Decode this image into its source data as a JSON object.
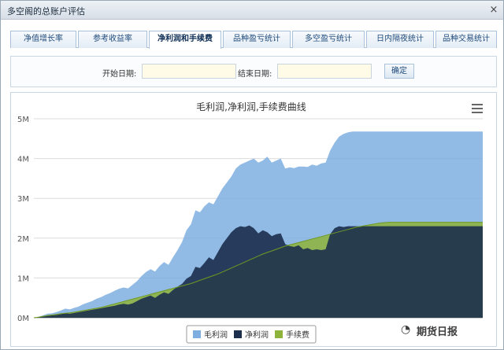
{
  "window": {
    "title": "多空阁的总账户评估",
    "close_glyph": "×"
  },
  "tabs": [
    {
      "label": "净值增长率",
      "active": false
    },
    {
      "label": "参考收益率",
      "active": false
    },
    {
      "label": "净利润和手续费",
      "active": true
    },
    {
      "label": "品种盈亏统计",
      "active": false
    },
    {
      "label": "多空盈亏统计",
      "active": false
    },
    {
      "label": "日内隔夜统计",
      "active": false
    },
    {
      "label": "品种交易统计",
      "active": false
    }
  ],
  "filter": {
    "start_label": "开始日期:",
    "start_value": "",
    "end_label": "结束日期:",
    "end_value": "",
    "confirm_label": "确定"
  },
  "menu_icon": "hamburger-menu-icon",
  "watermark": {
    "icon": "wechat-icon",
    "text": "期货日报"
  },
  "chart_data": {
    "type": "area",
    "title": "毛利润,净利润,手续费曲线",
    "xlabel": "",
    "ylabel": "",
    "ylim": [
      0,
      5000000
    ],
    "yticks": [
      "0M",
      "1M",
      "2M",
      "3M",
      "4M",
      "5M"
    ],
    "grid": true,
    "legend_position": "bottom",
    "x": [
      0,
      1,
      2,
      3,
      4,
      5,
      6,
      7,
      8,
      9,
      10,
      11,
      12,
      13,
      14,
      15,
      16,
      17,
      18,
      19,
      20,
      21,
      22,
      23,
      24,
      25,
      26,
      27,
      28,
      29,
      30,
      31,
      32,
      33,
      34,
      35,
      36,
      37,
      38,
      39,
      40,
      41,
      42,
      43,
      44,
      45,
      46,
      47,
      48,
      49,
      50,
      51,
      52,
      53,
      54,
      55,
      56,
      57,
      58,
      59,
      60,
      61,
      62,
      63,
      64,
      65,
      66,
      67,
      68,
      69,
      70,
      71,
      72,
      73,
      74,
      75,
      76,
      77,
      78,
      79,
      80,
      81,
      82,
      83,
      84,
      85,
      86,
      87,
      88,
      89,
      90,
      91,
      92,
      93,
      94,
      95,
      96,
      97,
      98,
      99,
      100
    ],
    "series": [
      {
        "name": "毛利润",
        "color": "#7eaee0",
        "values": [
          0,
          20000,
          60000,
          100000,
          110000,
          140000,
          180000,
          230000,
          210000,
          250000,
          280000,
          340000,
          380000,
          420000,
          480000,
          520000,
          580000,
          620000,
          680000,
          730000,
          760000,
          740000,
          830000,
          920000,
          1050000,
          1150000,
          1220000,
          1160000,
          1300000,
          1400000,
          1330000,
          1520000,
          1700000,
          1900000,
          2200000,
          2350000,
          2700000,
          2650000,
          2800000,
          2900000,
          2850000,
          3050000,
          3250000,
          3400000,
          3550000,
          3750000,
          3850000,
          3900000,
          3950000,
          4000000,
          3900000,
          3950000,
          4050000,
          3900000,
          3950000,
          4000000,
          3750000,
          3780000,
          3760000,
          3800000,
          3800000,
          3790000,
          3850000,
          3820000,
          3880000,
          3900000,
          4200000,
          4400000,
          4550000,
          4620000,
          4660000,
          4680000,
          4680000,
          4680000,
          4680000,
          4680000,
          4680000,
          4680000,
          4680000,
          4680000,
          4680000,
          4680000,
          4680000,
          4680000,
          4680000,
          4680000,
          4680000,
          4680000,
          4680000,
          4680000,
          4680000,
          4680000,
          4680000,
          4680000,
          4680000,
          4680000,
          4680000,
          4680000,
          4680000,
          4680000,
          4680000
        ]
      },
      {
        "name": "净利润",
        "color": "#1c2f4d",
        "values": [
          0,
          10000,
          30000,
          50000,
          60000,
          70000,
          90000,
          110000,
          100000,
          120000,
          140000,
          160000,
          180000,
          200000,
          220000,
          240000,
          260000,
          280000,
          300000,
          330000,
          350000,
          330000,
          360000,
          420000,
          480000,
          520000,
          560000,
          500000,
          580000,
          640000,
          600000,
          700000,
          780000,
          850000,
          980000,
          1050000,
          1280000,
          1250000,
          1380000,
          1520000,
          1450000,
          1650000,
          1850000,
          2000000,
          2150000,
          2250000,
          2300000,
          2280000,
          2320000,
          2250000,
          2120000,
          2200000,
          2150000,
          2050000,
          2100000,
          2120000,
          1850000,
          1800000,
          1780000,
          1820000,
          1720000,
          1750000,
          1700000,
          1720000,
          1700000,
          1720000,
          2100000,
          2250000,
          2300000,
          2280000,
          2300000,
          2300000,
          2300000,
          2300000,
          2300000,
          2300000,
          2300000,
          2300000,
          2300000,
          2300000,
          2300000,
          2300000,
          2300000,
          2300000,
          2300000,
          2300000,
          2300000,
          2300000,
          2300000,
          2300000,
          2300000,
          2300000,
          2300000,
          2300000,
          2300000,
          2300000,
          2300000,
          2300000,
          2300000,
          2300000,
          2300000
        ]
      },
      {
        "name": "手续费",
        "color": "#8db33a",
        "values": [
          0,
          15000,
          35000,
          55000,
          70000,
          85000,
          100000,
          115000,
          125000,
          140000,
          160000,
          180000,
          200000,
          220000,
          240000,
          260000,
          290000,
          320000,
          350000,
          380000,
          410000,
          440000,
          470000,
          500000,
          530000,
          560000,
          590000,
          620000,
          650000,
          680000,
          710000,
          740000,
          770000,
          800000,
          830000,
          860000,
          900000,
          940000,
          980000,
          1020000,
          1060000,
          1100000,
          1150000,
          1200000,
          1250000,
          1300000,
          1350000,
          1400000,
          1450000,
          1500000,
          1550000,
          1600000,
          1640000,
          1680000,
          1720000,
          1760000,
          1800000,
          1830000,
          1860000,
          1890000,
          1920000,
          1950000,
          1980000,
          2010000,
          2040000,
          2070000,
          2100000,
          2130000,
          2160000,
          2190000,
          2220000,
          2250000,
          2280000,
          2300000,
          2320000,
          2340000,
          2360000,
          2380000,
          2390000,
          2400000,
          2400000,
          2400000,
          2400000,
          2400000,
          2400000,
          2400000,
          2400000,
          2400000,
          2400000,
          2400000,
          2400000,
          2400000,
          2400000,
          2400000,
          2400000,
          2400000,
          2400000,
          2400000,
          2400000,
          2400000,
          2400000
        ]
      }
    ]
  }
}
